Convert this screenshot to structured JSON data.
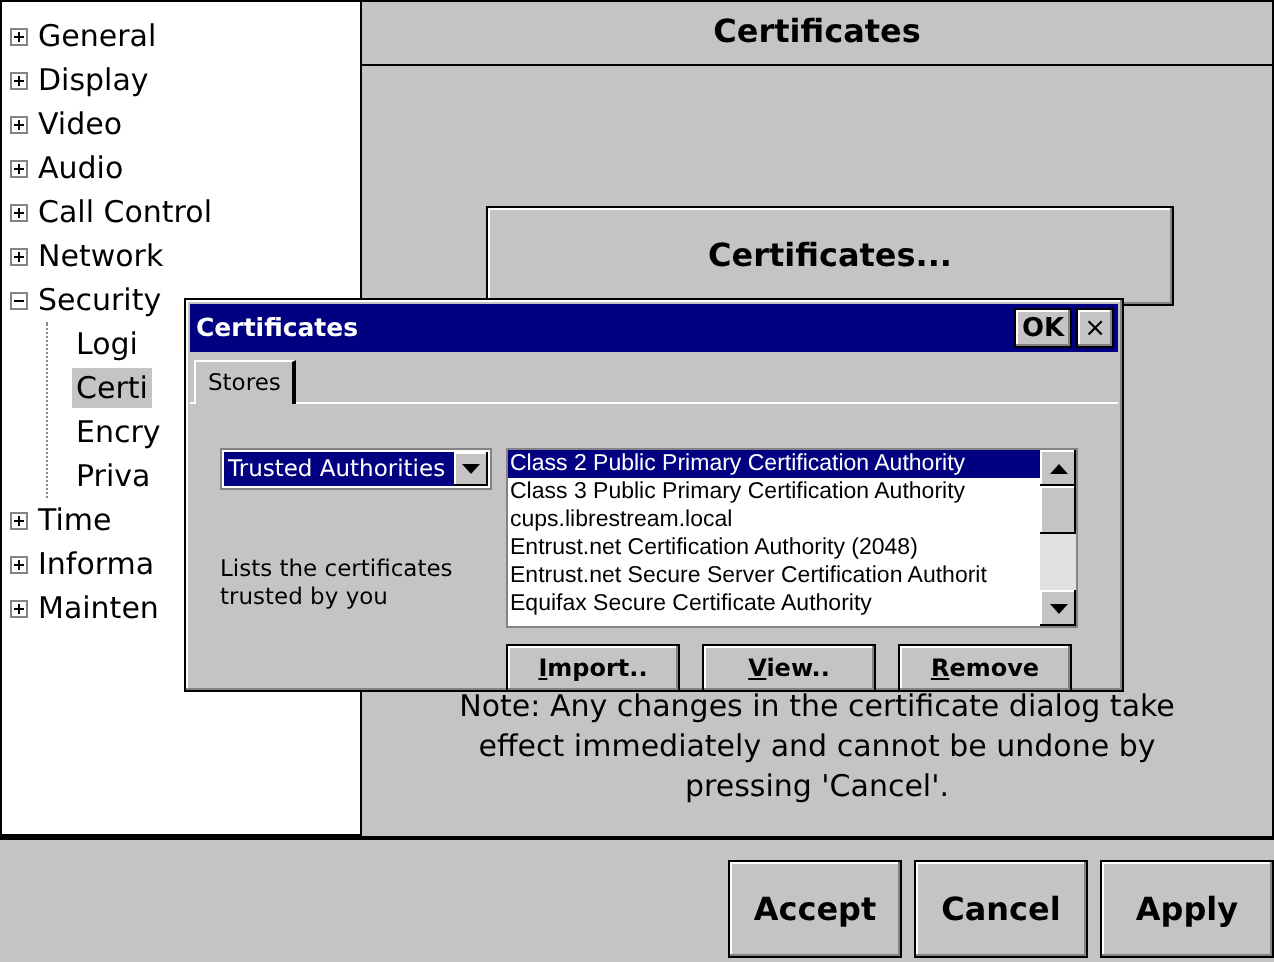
{
  "tree": {
    "items": [
      {
        "label": "General",
        "expanded": false,
        "selected": false
      },
      {
        "label": "Display",
        "expanded": false,
        "selected": false
      },
      {
        "label": "Video",
        "expanded": false,
        "selected": false
      },
      {
        "label": "Audio",
        "expanded": false,
        "selected": false
      },
      {
        "label": "Call Control",
        "expanded": false,
        "selected": false
      },
      {
        "label": "Network",
        "expanded": false,
        "selected": false
      },
      {
        "label": "Security",
        "expanded": true,
        "selected": false,
        "children": [
          {
            "label": "Logi",
            "selected": false
          },
          {
            "label": "Certi",
            "selected": true
          },
          {
            "label": "Encry",
            "selected": false
          },
          {
            "label": "Priva",
            "selected": false
          }
        ]
      },
      {
        "label": "Time",
        "expanded": false,
        "selected": false
      },
      {
        "label": "Informa",
        "expanded": false,
        "selected": false
      },
      {
        "label": "Mainten",
        "expanded": false,
        "selected": false
      }
    ]
  },
  "panel": {
    "title": "Certificates",
    "button": "Certificates...",
    "note": "Note: Any changes in the certificate dialog take effect immediately and cannot be undone by pressing 'Cancel'."
  },
  "dialog": {
    "title": "Certificates",
    "ok": "OK",
    "close": "×",
    "tabs": [
      {
        "label": "Stores",
        "selected": true
      }
    ],
    "store": "Trusted Authorities",
    "description": "Lists the certificates trusted by you",
    "certificates": [
      {
        "label": "Class 2 Public Primary Certification Authority",
        "selected": true
      },
      {
        "label": "Class 3 Public Primary Certification Authority",
        "selected": false
      },
      {
        "label": "cups.librestream.local",
        "selected": false
      },
      {
        "label": "Entrust.net Certification Authority (2048)",
        "selected": false
      },
      {
        "label": "Entrust.net Secure Server Certification Authorit",
        "selected": false
      },
      {
        "label": "Equifax Secure Certificate Authority",
        "selected": false
      }
    ],
    "buttons": [
      {
        "label": "Import..",
        "mnemonic_first": true
      },
      {
        "label": "View..",
        "mnemonic_first": true
      },
      {
        "label": "Remove",
        "mnemonic_first": true
      }
    ]
  },
  "footer": {
    "buttons": [
      "Accept",
      "Cancel",
      "Apply"
    ]
  }
}
